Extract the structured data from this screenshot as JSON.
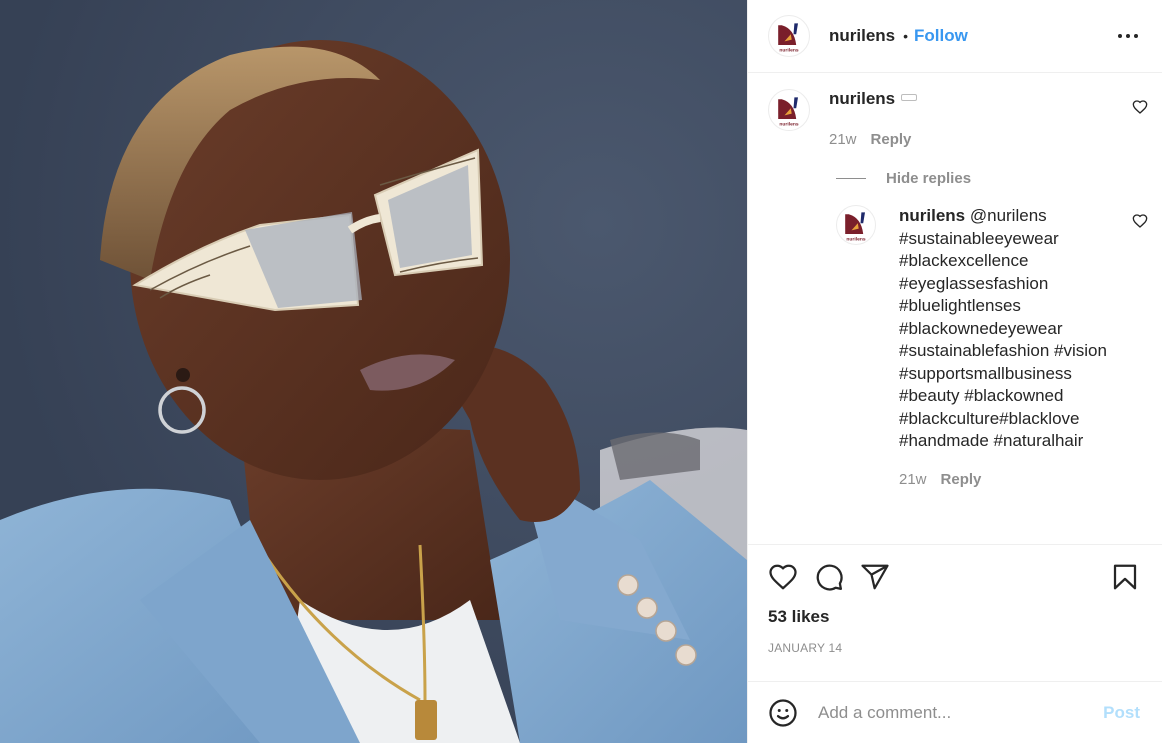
{
  "post": {
    "image_alt": "Woman with short bleached hair wearing white wood-grain cat-eye glasses and a light blue denim blazer, resting her chin on her hand",
    "author": {
      "username": "nurilens",
      "avatar_icon": "nurilens-logo",
      "avatar_caption": "nurilens",
      "follow_label": "Follow",
      "separator": "•"
    },
    "more_icon": "more-options-icon",
    "comments": [
      {
        "username": "nurilens",
        "emoji_icon": "glasses-emoji",
        "age": "21w",
        "reply_label": "Reply",
        "hide_replies_label": "Hide replies",
        "replies": [
          {
            "username": "nurilens",
            "mention": "@nurilens",
            "tag_lines": [
              [
                "#sustainableeyewear"
              ],
              [
                "#blackexcellence"
              ],
              [
                "#eyeglassesfashion"
              ],
              [
                "#bluelightlenses"
              ],
              [
                "#blackownedeyewear"
              ],
              [
                "#sustainablefashion",
                "#vision"
              ],
              [
                "#supportsmallbusiness"
              ],
              [
                "#beauty",
                "#blackowned"
              ],
              [
                "#blackculture#blacklove"
              ],
              [
                "#handmade",
                "#naturalhair"
              ]
            ],
            "age": "21w",
            "reply_label": "Reply"
          }
        ]
      }
    ],
    "actions": {
      "like_icon": "heart-icon",
      "comment_icon": "comment-icon",
      "share_icon": "share-icon",
      "save_icon": "bookmark-icon"
    },
    "likes_label": "53 likes",
    "date": "JANUARY 14",
    "add_comment": {
      "placeholder": "Add a comment...",
      "value": "",
      "post_label": "Post",
      "emoji_icon": "smiley-icon"
    }
  },
  "colors": {
    "link_blue": "#3897f0",
    "post_disabled": "#b2dffc",
    "text_primary": "#262626",
    "text_secondary": "#8e8e8e",
    "divider": "#efefef",
    "logo_maroon": "#7a1f2b",
    "logo_navy": "#1f2a6b",
    "logo_orange": "#e8a13a"
  }
}
